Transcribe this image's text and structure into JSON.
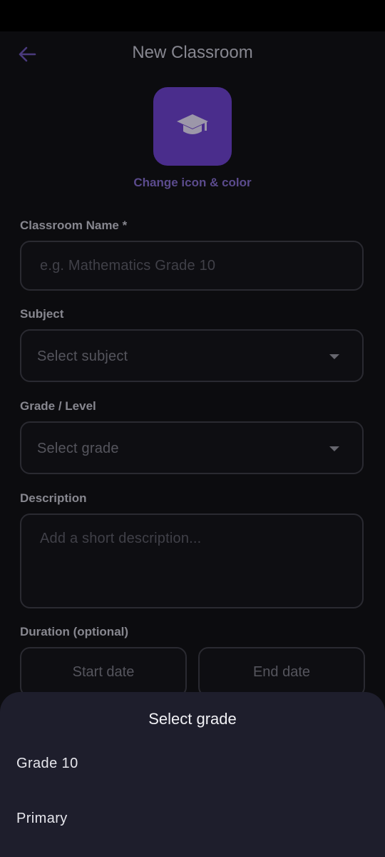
{
  "app_bar": {
    "title": "New Classroom",
    "back_icon": "arrow-left-icon"
  },
  "icon_picker": {
    "icon": "graduation-cap-icon",
    "color": "#4a2d8c",
    "change_label": "Change icon & color"
  },
  "form": {
    "name": {
      "label": "Classroom Name *",
      "placeholder": "e.g. Mathematics Grade 10"
    },
    "subject": {
      "label": "Subject",
      "value": "Select subject"
    },
    "grade": {
      "label": "Grade / Level",
      "value": "Select grade"
    },
    "description": {
      "label": "Description",
      "placeholder": "Add a short description..."
    },
    "duration": {
      "label": "Duration (optional)",
      "start": "Start date",
      "end": "End date"
    }
  },
  "sheet": {
    "title": "Select grade",
    "options": [
      {
        "label": "Grade 10"
      },
      {
        "label": "Primary"
      }
    ]
  },
  "colors": {
    "accent": "#4a2d8c",
    "accent_text": "#5b4b8d",
    "background": "#0c0c0f",
    "sheet": "#1e1e2c"
  }
}
